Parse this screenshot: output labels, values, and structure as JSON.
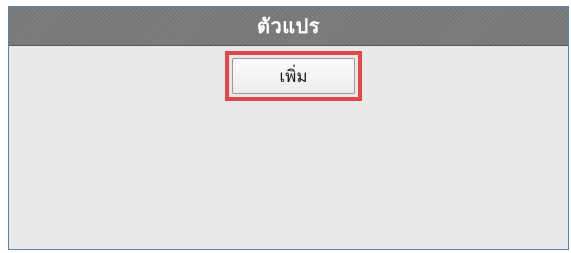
{
  "panel": {
    "title": "ตัวแปร",
    "add_button_label": "เพิ่ม"
  },
  "colors": {
    "header_bg": "#7a7a7a",
    "panel_bg": "#e9e9e9",
    "panel_border": "#5b7fb4",
    "highlight": "#e2474b"
  }
}
